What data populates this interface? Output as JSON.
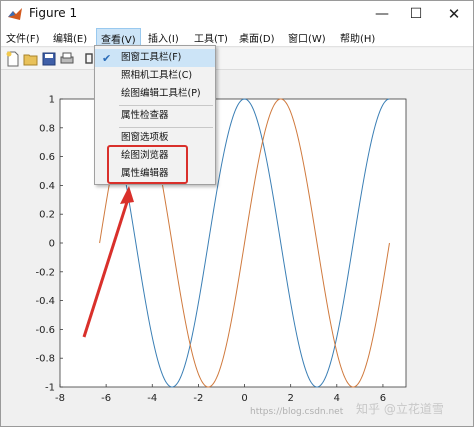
{
  "window": {
    "title": "Figure 1"
  },
  "window_controls": {
    "minimize": "—",
    "maximize": "☐",
    "close": "✕"
  },
  "menubar": [
    {
      "label": "文件(F)"
    },
    {
      "label": "编辑(E)"
    },
    {
      "label": "查看(V)"
    },
    {
      "label": "插入(I)"
    },
    {
      "label": "工具(T)"
    },
    {
      "label": "桌面(D)"
    },
    {
      "label": "窗口(W)"
    },
    {
      "label": "帮助(H)"
    }
  ],
  "toolbar": {
    "icons": [
      "new-file-icon",
      "open-folder-icon",
      "save-icon",
      "print-icon",
      "link-icon"
    ]
  },
  "view_menu": {
    "items": [
      {
        "label": "图窗工具栏(F)",
        "checked": true
      },
      {
        "label": "照相机工具栏(C)",
        "checked": false
      },
      {
        "label": "绘图编辑工具栏(P)",
        "checked": false
      },
      {
        "label": "属性检查器",
        "checked": false
      },
      {
        "label": "图窗选项板",
        "checked": false
      },
      {
        "label": "绘图浏览器",
        "checked": false
      },
      {
        "label": "属性编辑器",
        "checked": false
      }
    ],
    "checkmark": "✔"
  },
  "colors": {
    "series1": "#3b7fb5",
    "series2": "#d07a3e",
    "highlight": "#d9302b",
    "menu_active": "#cce4f7"
  },
  "chart_data": {
    "type": "line",
    "xlim": [
      -8,
      7
    ],
    "ylim": [
      -1,
      1
    ],
    "xticks": [
      -8,
      -6,
      -4,
      -2,
      0,
      2,
      4,
      6
    ],
    "yticks": [
      -1,
      -0.8,
      -0.6,
      -0.4,
      -0.2,
      0,
      0.2,
      0.4,
      0.6,
      0.8,
      1
    ],
    "xtick_labels": [
      "-8",
      "-6",
      "-4",
      "-2",
      "0",
      "2",
      "4",
      "6"
    ],
    "ytick_labels": [
      "-1",
      "-0.8",
      "-0.6",
      "-0.4",
      "-0.2",
      "0",
      "0.2",
      "0.4",
      "0.6",
      "0.8",
      "1"
    ],
    "grid": false,
    "series": [
      {
        "function": "cos",
        "x_range": [
          -6.2832,
          6.2832
        ],
        "color": "#3b7fb5"
      },
      {
        "function": "sin",
        "x_range": [
          -6.2832,
          6.2832
        ],
        "color": "#d07a3e"
      }
    ]
  },
  "watermark": {
    "url": "https://blog.csdn.net",
    "author": "知乎 @立花道雪"
  }
}
